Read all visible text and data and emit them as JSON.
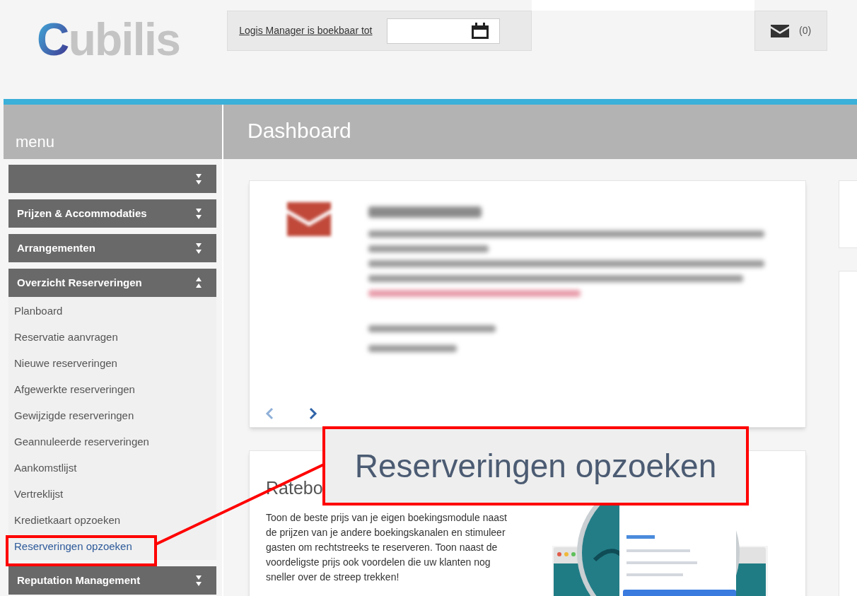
{
  "header": {
    "logo": "Cubilis",
    "booking_notice": {
      "link": "Logis Manager is boekbaar tot"
    },
    "messages": {
      "count": "(0)"
    }
  },
  "menu_label": "menu",
  "page_title": "Dashboard",
  "sidebar": {
    "sections": [
      {
        "expanded": false
      },
      {
        "label": "Prijzen & Accommodaties",
        "expanded": false
      },
      {
        "label": "Arrangementen",
        "expanded": false
      },
      {
        "label": "Overzicht Reserveringen",
        "expanded": true,
        "items": [
          {
            "label": "Planboard",
            "selected": false
          },
          {
            "label": "Reservatie aanvragen",
            "selected": false
          },
          {
            "label": "Nieuwe reserveringen",
            "selected": false
          },
          {
            "label": "Afgewerkte reserveringen",
            "selected": false
          },
          {
            "label": "Gewijzigde reserveringen",
            "selected": false
          },
          {
            "label": "Geannuleerde reserveringen",
            "selected": false
          },
          {
            "label": "Aankomstlijst",
            "selected": false
          },
          {
            "label": "Vertreklijst",
            "selected": false
          },
          {
            "label": "Kredietkaart opzoeken",
            "selected": false
          },
          {
            "label": "Reserveringen opzoeken",
            "selected": true
          }
        ]
      },
      {
        "label": "Reputation Management",
        "expanded": false
      }
    ]
  },
  "carousel": {
    "previous": {
      "disabled": true
    },
    "next": {
      "disabled": false
    }
  },
  "promo_card": {
    "title": "Ratebo",
    "body": "Toon de beste prijs van je eigen boekingsmodule naast de prijzen van je andere boekingskanalen en stimuleer gasten om rechtstreeks te reserveren. Toon naast de voordeligste prijs ook voordelen die uw klanten nog sneller over de streep trekken!"
  },
  "callout": {
    "text": "Reserveringen opzoeken"
  }
}
